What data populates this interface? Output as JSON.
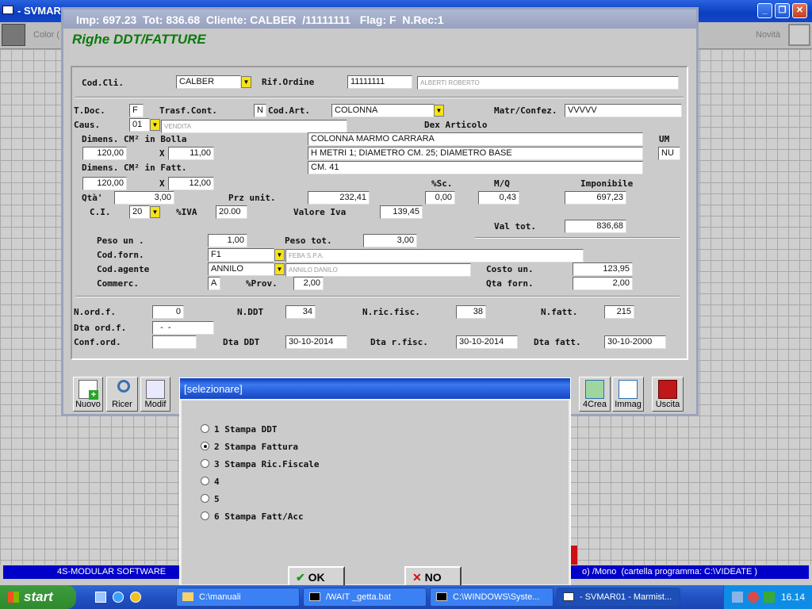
{
  "main_window": {
    "title": "- SVMARO",
    "color_label": "Color (",
    "novita_label": "Novità"
  },
  "form": {
    "titlebar": "Imp: 697.23  Tot: 836.68  Cliente: CALBER  /11111111   Flag: F  N.Rec:1",
    "heading": "Righe DDT/FATTURE",
    "cod_cli_label": "Cod.Cli.",
    "cod_cli": "CALBER",
    "rif_ordine_label": "Rif.Ordine",
    "rif_ordine": "11111111",
    "cliente_nome": "ALBERTI ROBERTO",
    "tdoc_label": "T.Doc.",
    "tdoc": "F",
    "trasf_label": "Trasf.Cont.",
    "trasf": "N",
    "cod_art_label": "Cod.Art.",
    "cod_art": "COLONNA",
    "matr_label": "Matr/Confez.",
    "matr": "VVVVV",
    "caus_label": "Caus.",
    "caus": "01",
    "caus_desc": "VENDITA",
    "dex_label": "Dex Articolo",
    "dim_bolla_label": "Dimens. CM² in Bolla",
    "dex1": "COLONNA MARMO CARRARA",
    "dex2": "H METRI 1; DIAMETRO CM. 25; DIAMETRO BASE",
    "dex3": "CM. 41",
    "um_label": "UM",
    "um": "NU",
    "dim_bolla_a": "120,00",
    "x1": "X",
    "dim_bolla_b": "11,00",
    "dim_fatt_label": "Dimens. CM² in Fatt.",
    "dim_fatt_a": "120,00",
    "x2": "X",
    "dim_fatt_b": "12,00",
    "sc_label": "%Sc.",
    "mq_label": "M/Q",
    "imponibile_label": "Imponibile",
    "qta_label": "Qtà'",
    "qta": "3,00",
    "prz_label": "Prz unit.",
    "prz": "232,41",
    "sc": "0,00",
    "mq": "0,43",
    "imponibile": "697,23",
    "ci_label": "C.I.",
    "ci": "20",
    "iva_label": "%IVA",
    "iva": "20.00",
    "val_iva_label": "Valore Iva",
    "val_iva": "139,45",
    "val_tot_label": "Val tot.",
    "val_tot": "836,68",
    "peso_un_label": "Peso un .",
    "peso_un": "1,00",
    "peso_tot_label": "Peso tot.",
    "peso_tot": "3,00",
    "cod_forn_label": "Cod.forn.",
    "cod_forn": "F1",
    "forn_nome": "FEBA S.P.A.",
    "cod_agente_label": "Cod.agente",
    "cod_agente": "ANNILO",
    "agente_nome": "ANNILO DANILO",
    "costo_label": "Costo un.",
    "costo": "123,95",
    "commerc_label": "Commerc.",
    "commerc": "A",
    "prov_label": "%Prov.",
    "prov": "2,00",
    "qta_forn_label": "Qta forn.",
    "qta_forn": "2,00",
    "nordf_label": "N.ord.f.",
    "nordf": "0",
    "nddt_label": "N.DDT",
    "nddt": "34",
    "nric_label": "N.ric.fisc.",
    "nric": "38",
    "nfatt_label": "N.fatt.",
    "nfatt": "215",
    "dta_ordf_label": "Dta ord.f.",
    "dta_ordf": "  -  -",
    "conf_label": "Conf.ord.",
    "conf": "",
    "dta_ddt_label": "Dta DDT",
    "dta_ddt": "30-10-2014",
    "dta_rfisc_label": "Dta r.fisc.",
    "dta_rfisc": "30-10-2014",
    "dta_fatt_label": "Dta fatt.",
    "dta_fatt": "30-10-2000"
  },
  "toolbar": {
    "nuovo": "Nuovo",
    "ricer": "Ricer",
    "modif": "Modif",
    "crea": "4Crea",
    "immag": "Immag",
    "uscita": "Uscita"
  },
  "dialog": {
    "title": "[selezionare]",
    "options": [
      "1 Stampa DDT",
      "2 Stampa Fattura",
      "3 Stampa Ric.Fiscale",
      "4",
      "5",
      "6 Stampa Fatt/Acc"
    ],
    "selected": 1,
    "ok": "OK",
    "no": "NO"
  },
  "status": {
    "left": "4S-MODULAR SOFTWARE",
    "right": "o) /Mono  (cartella programma: C:\\VIDEATE )"
  },
  "taskbar": {
    "start": "start",
    "tasks": [
      "C:\\manuali",
      "/WAIT _getta.bat",
      "C:\\WINDOWS\\Syste...",
      "- SVMAR01 - Marmist..."
    ],
    "clock": "16.14"
  },
  "colors": {
    "accent": "#0a3fc0",
    "heading_green": "#0a7a0a",
    "dropdown_yellow": "#f4e31a"
  }
}
